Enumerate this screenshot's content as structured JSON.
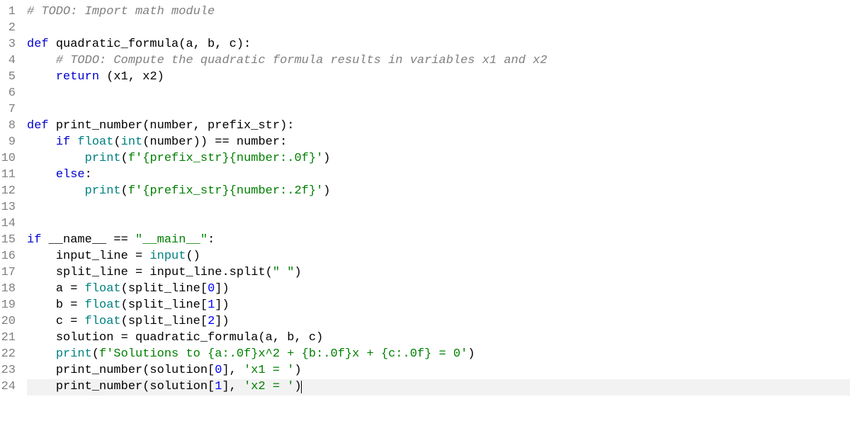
{
  "lineNumbers": [
    "1",
    "2",
    "3",
    "4",
    "5",
    "6",
    "7",
    "8",
    "9",
    "10",
    "11",
    "12",
    "13",
    "14",
    "15",
    "16",
    "17",
    "18",
    "19",
    "20",
    "21",
    "22",
    "23",
    "24"
  ],
  "code": {
    "l1": {
      "comment": "# TODO: Import math module"
    },
    "l3": {
      "kw_def": "def",
      "fn": "quadratic_formula",
      "params": "(a, b, c):"
    },
    "l4": {
      "comment": "# TODO: Compute the quadratic formula results in variables x1 and x2"
    },
    "l5": {
      "kw_return": "return",
      "rest": " (x1, x2)"
    },
    "l8": {
      "kw_def": "def",
      "fn": "print_number",
      "params": "(number, prefix_str):"
    },
    "l9": {
      "kw_if": "if",
      "float": "float",
      "int": "int",
      "mid1": "(",
      "mid2": "(number)) == number:"
    },
    "l10": {
      "print": "print",
      "p1": "(",
      "fpref": "f",
      "str": "'{prefix_str}{number:.0f}'",
      "p2": ")"
    },
    "l11": {
      "kw_else": "else",
      "colon": ":"
    },
    "l12": {
      "print": "print",
      "p1": "(",
      "fpref": "f",
      "str": "'{prefix_str}{number:.2f}'",
      "p2": ")"
    },
    "l15": {
      "kw_if": "if",
      "name": " __name__ == ",
      "str": "\"__main__\"",
      "colon": ":"
    },
    "l16": {
      "var": "input_line = ",
      "input": "input",
      "rest": "()"
    },
    "l17": {
      "var": "split_line = input_line.",
      "split": "split",
      "p1": "(",
      "str": "\" \"",
      "p2": ")"
    },
    "l18": {
      "var": "a = ",
      "float": "float",
      "rest": "(split_line[",
      "idx": "0",
      "rest2": "])"
    },
    "l19": {
      "var": "b = ",
      "float": "float",
      "rest": "(split_line[",
      "idx": "1",
      "rest2": "])"
    },
    "l20": {
      "var": "c = ",
      "float": "float",
      "rest": "(split_line[",
      "idx": "2",
      "rest2": "])"
    },
    "l21": {
      "rest": "solution = quadratic_formula(a, b, c)"
    },
    "l22": {
      "print": "print",
      "p1": "(",
      "fpref": "f",
      "str": "'Solutions to {a:.0f}x^2 + {b:.0f}x + {c:.0f} = 0'",
      "p2": ")"
    },
    "l23": {
      "fn": "print_number",
      "p1": "(solution[",
      "idx": "0",
      "mid": "], ",
      "str": "'x1 = '",
      "p2": ")"
    },
    "l24": {
      "fn": "print_number",
      "p1": "(solution[",
      "idx": "1",
      "mid": "], ",
      "str": "'x2 = '",
      "p2": ")"
    }
  }
}
